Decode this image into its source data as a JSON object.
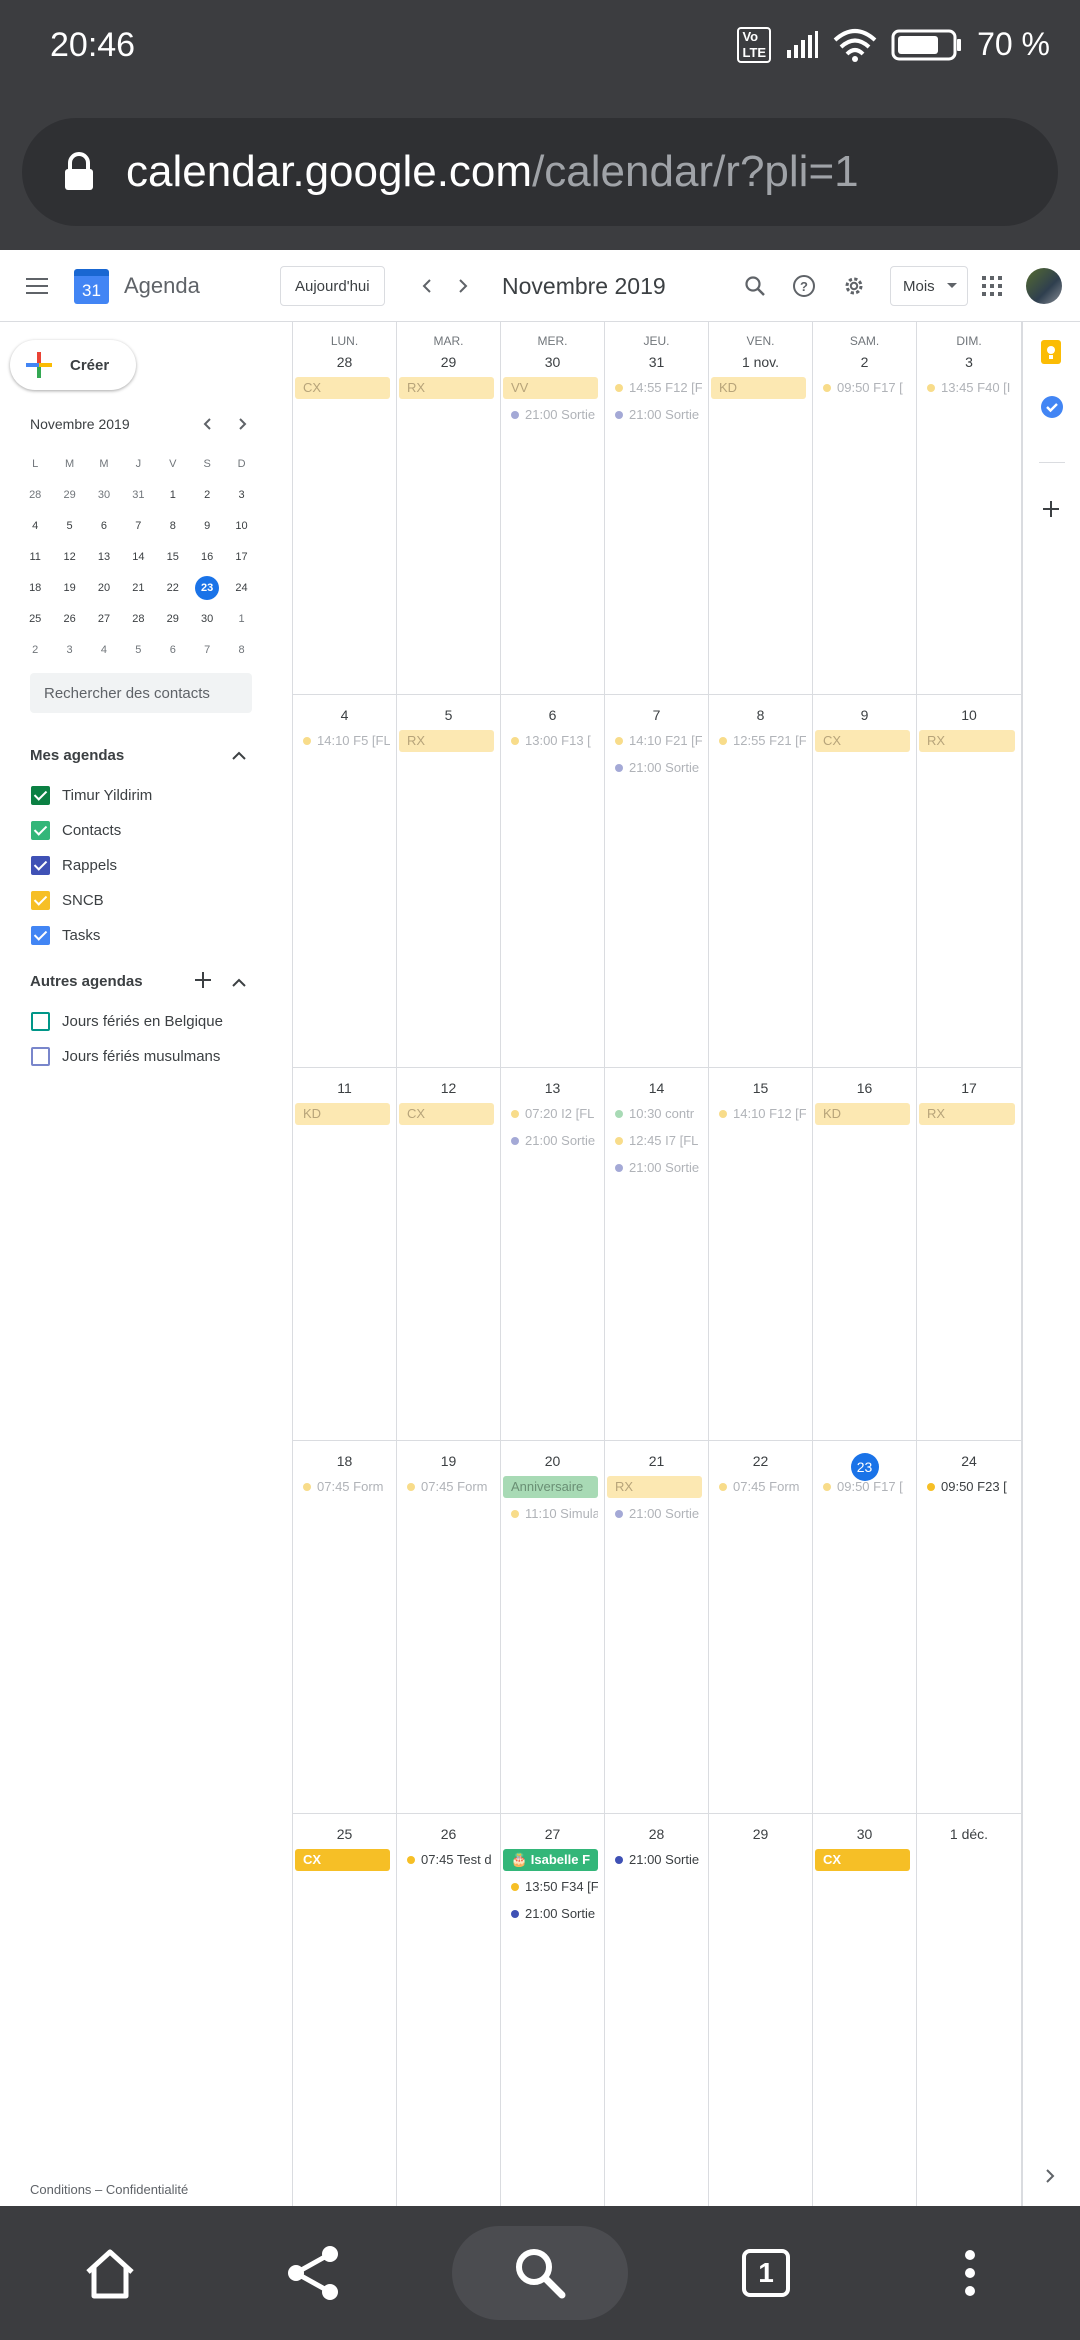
{
  "status_bar": {
    "time": "20:46",
    "battery": "70 %"
  },
  "browser": {
    "url_host": "calendar.google.com",
    "url_path": "/calendar/r?pli=1"
  },
  "header": {
    "app_title": "Agenda",
    "logo_day": "31",
    "today_button": "Aujourd'hui",
    "month_title": "Novembre 2019",
    "view_select": "Mois"
  },
  "sidebar": {
    "create_label": "Créer",
    "mini_calendar": {
      "title": "Novembre 2019",
      "weekdays": [
        "L",
        "M",
        "M",
        "J",
        "V",
        "S",
        "D"
      ],
      "weeks": [
        [
          "28",
          "29",
          "30",
          "31",
          "1",
          "2",
          "3"
        ],
        [
          "4",
          "5",
          "6",
          "7",
          "8",
          "9",
          "10"
        ],
        [
          "11",
          "12",
          "13",
          "14",
          "15",
          "16",
          "17"
        ],
        [
          "18",
          "19",
          "20",
          "21",
          "22",
          "23",
          "24"
        ],
        [
          "25",
          "26",
          "27",
          "28",
          "29",
          "30",
          "1"
        ],
        [
          "2",
          "3",
          "4",
          "5",
          "6",
          "7",
          "8"
        ]
      ]
    },
    "search_contacts_placeholder": "Rechercher des contacts",
    "my_calendars_title": "Mes agendas",
    "my_calendars": [
      {
        "label": "Timur Yildirim",
        "color": "#0b8043",
        "checked": true
      },
      {
        "label": "Contacts",
        "color": "#33b679",
        "checked": true
      },
      {
        "label": "Rappels",
        "color": "#3f51b5",
        "checked": true
      },
      {
        "label": "SNCB",
        "color": "#f6bf26",
        "checked": true
      },
      {
        "label": "Tasks",
        "color": "#4285f4",
        "checked": true
      }
    ],
    "other_calendars_title": "Autres agendas",
    "other_calendars": [
      {
        "label": "Jours fériés en Belgique",
        "color": "#009688",
        "checked": false
      },
      {
        "label": "Jours fériés musulmans",
        "color": "#7986cb",
        "checked": false
      }
    ],
    "footer": "Conditions – Confidentialité"
  },
  "month": {
    "weekday_labels": [
      "LUN.",
      "MAR.",
      "MER.",
      "JEU.",
      "VEN.",
      "SAM.",
      "DIM."
    ],
    "weeks": [
      {
        "days": [
          {
            "num": "28",
            "events": [
              {
                "kind": "bar",
                "text": "CX"
              }
            ]
          },
          {
            "num": "29",
            "events": [
              {
                "kind": "bar",
                "text": "RX"
              }
            ]
          },
          {
            "num": "30",
            "events": [
              {
                "kind": "bar",
                "text": "VV"
              },
              {
                "kind": "dot",
                "text": "21:00 Sortie",
                "color": "#a4a9d6"
              }
            ]
          },
          {
            "num": "31",
            "events": [
              {
                "kind": "dot",
                "text": "14:55 F12 [F",
                "color": "#f8dc8a"
              },
              {
                "kind": "dot",
                "text": "21:00 Sortie",
                "color": "#a4a9d6"
              }
            ]
          },
          {
            "num": "1 nov.",
            "events": [
              {
                "kind": "bar",
                "text": "KD"
              }
            ]
          },
          {
            "num": "2",
            "events": [
              {
                "kind": "dot",
                "text": "09:50 F17 [",
                "color": "#f8dc8a"
              }
            ]
          },
          {
            "num": "3",
            "events": [
              {
                "kind": "dot",
                "text": "13:45 F40 [I",
                "color": "#f8dc8a"
              }
            ]
          }
        ]
      },
      {
        "days": [
          {
            "num": "4",
            "events": [
              {
                "kind": "dot",
                "text": "14:10 F5 [FL",
                "color": "#f8dc8a"
              }
            ]
          },
          {
            "num": "5",
            "events": [
              {
                "kind": "bar",
                "text": "RX"
              }
            ]
          },
          {
            "num": "6",
            "events": [
              {
                "kind": "dot",
                "text": "13:00 F13 [",
                "color": "#f8dc8a"
              }
            ]
          },
          {
            "num": "7",
            "events": [
              {
                "kind": "dot",
                "text": "14:10 F21 [F",
                "color": "#f8dc8a"
              },
              {
                "kind": "dot",
                "text": "21:00 Sortie",
                "color": "#a4a9d6"
              }
            ]
          },
          {
            "num": "8",
            "events": [
              {
                "kind": "dot",
                "text": "12:55 F21 [F",
                "color": "#f8dc8a"
              }
            ]
          },
          {
            "num": "9",
            "events": [
              {
                "kind": "bar",
                "text": "CX"
              }
            ]
          },
          {
            "num": "10",
            "events": [
              {
                "kind": "bar",
                "text": "RX"
              }
            ]
          }
        ]
      },
      {
        "days": [
          {
            "num": "11",
            "events": [
              {
                "kind": "bar",
                "text": "KD"
              }
            ]
          },
          {
            "num": "12",
            "events": [
              {
                "kind": "bar",
                "text": "CX"
              }
            ]
          },
          {
            "num": "13",
            "events": [
              {
                "kind": "dot",
                "text": "07:20 I2 [FL",
                "color": "#f8dc8a"
              },
              {
                "kind": "dot",
                "text": "21:00 Sortie",
                "color": "#a4a9d6"
              }
            ]
          },
          {
            "num": "14",
            "events": [
              {
                "kind": "dot",
                "text": "10:30 contr",
                "color": "#a8dab5"
              },
              {
                "kind": "dot",
                "text": "12:45 I7 [FL",
                "color": "#f8dc8a"
              },
              {
                "kind": "dot",
                "text": "21:00 Sortie",
                "color": "#a4a9d6"
              }
            ]
          },
          {
            "num": "15",
            "events": [
              {
                "kind": "dot",
                "text": "14:10 F12 [F",
                "color": "#f8dc8a"
              }
            ]
          },
          {
            "num": "16",
            "events": [
              {
                "kind": "bar",
                "text": "KD"
              }
            ]
          },
          {
            "num": "17",
            "events": [
              {
                "kind": "bar",
                "text": "RX"
              }
            ]
          }
        ]
      },
      {
        "days": [
          {
            "num": "18",
            "events": [
              {
                "kind": "dot",
                "text": "07:45 Form",
                "color": "#f8dc8a"
              }
            ]
          },
          {
            "num": "19",
            "events": [
              {
                "kind": "dot",
                "text": "07:45 Form",
                "color": "#f8dc8a"
              }
            ]
          },
          {
            "num": "20",
            "events": [
              {
                "kind": "bar-green",
                "text": "Anniversaire"
              },
              {
                "kind": "dot",
                "text": "11:10 Simula",
                "color": "#f8dc8a"
              }
            ]
          },
          {
            "num": "21",
            "events": [
              {
                "kind": "bar",
                "text": "RX"
              },
              {
                "kind": "dot",
                "text": "21:00 Sortie",
                "color": "#a4a9d6"
              }
            ]
          },
          {
            "num": "22",
            "events": [
              {
                "kind": "dot",
                "text": "07:45 Form",
                "color": "#f8dc8a"
              }
            ]
          },
          {
            "num": "23",
            "today": true,
            "events": [
              {
                "kind": "dot",
                "text": "09:50 F17 [",
                "color": "#f8dc8a"
              }
            ]
          },
          {
            "num": "24",
            "events": [
              {
                "kind": "dot-dark",
                "text": "09:50 F23 [",
                "color": "#f6bf26"
              }
            ]
          }
        ]
      },
      {
        "days": [
          {
            "num": "25",
            "events": [
              {
                "kind": "bar-solid",
                "text": "CX"
              }
            ]
          },
          {
            "num": "26",
            "events": [
              {
                "kind": "dot-dark",
                "text": "07:45 Test d",
                "color": "#f6bf26"
              }
            ]
          },
          {
            "num": "27",
            "events": [
              {
                "kind": "bar-greensolid",
                "text": "🎂 Isabelle F"
              },
              {
                "kind": "dot-dark",
                "text": "13:50 F34 [F",
                "color": "#f6bf26"
              },
              {
                "kind": "dot-dark",
                "text": "21:00 Sortie",
                "color": "#3f51b5"
              }
            ]
          },
          {
            "num": "28",
            "events": [
              {
                "kind": "dot-dark",
                "text": "21:00 Sortie",
                "color": "#3f51b5"
              }
            ]
          },
          {
            "num": "29",
            "events": []
          },
          {
            "num": "30",
            "events": [
              {
                "kind": "bar-solid",
                "text": "CX"
              }
            ]
          },
          {
            "num": "1 déc.",
            "events": []
          }
        ]
      }
    ]
  },
  "colors": {
    "accent": "#1a73e8",
    "chrome": "#3c3d40"
  },
  "icons": {
    "menu": "hamburger-menu-icon",
    "search": "search-icon",
    "help": "help-icon",
    "settings": "gear-icon",
    "apps": "apps-grid-icon",
    "keep": "keep-icon",
    "tasks": "tasks-icon",
    "add": "plus-icon"
  },
  "bottom_nav": {
    "tab_count": "1"
  }
}
